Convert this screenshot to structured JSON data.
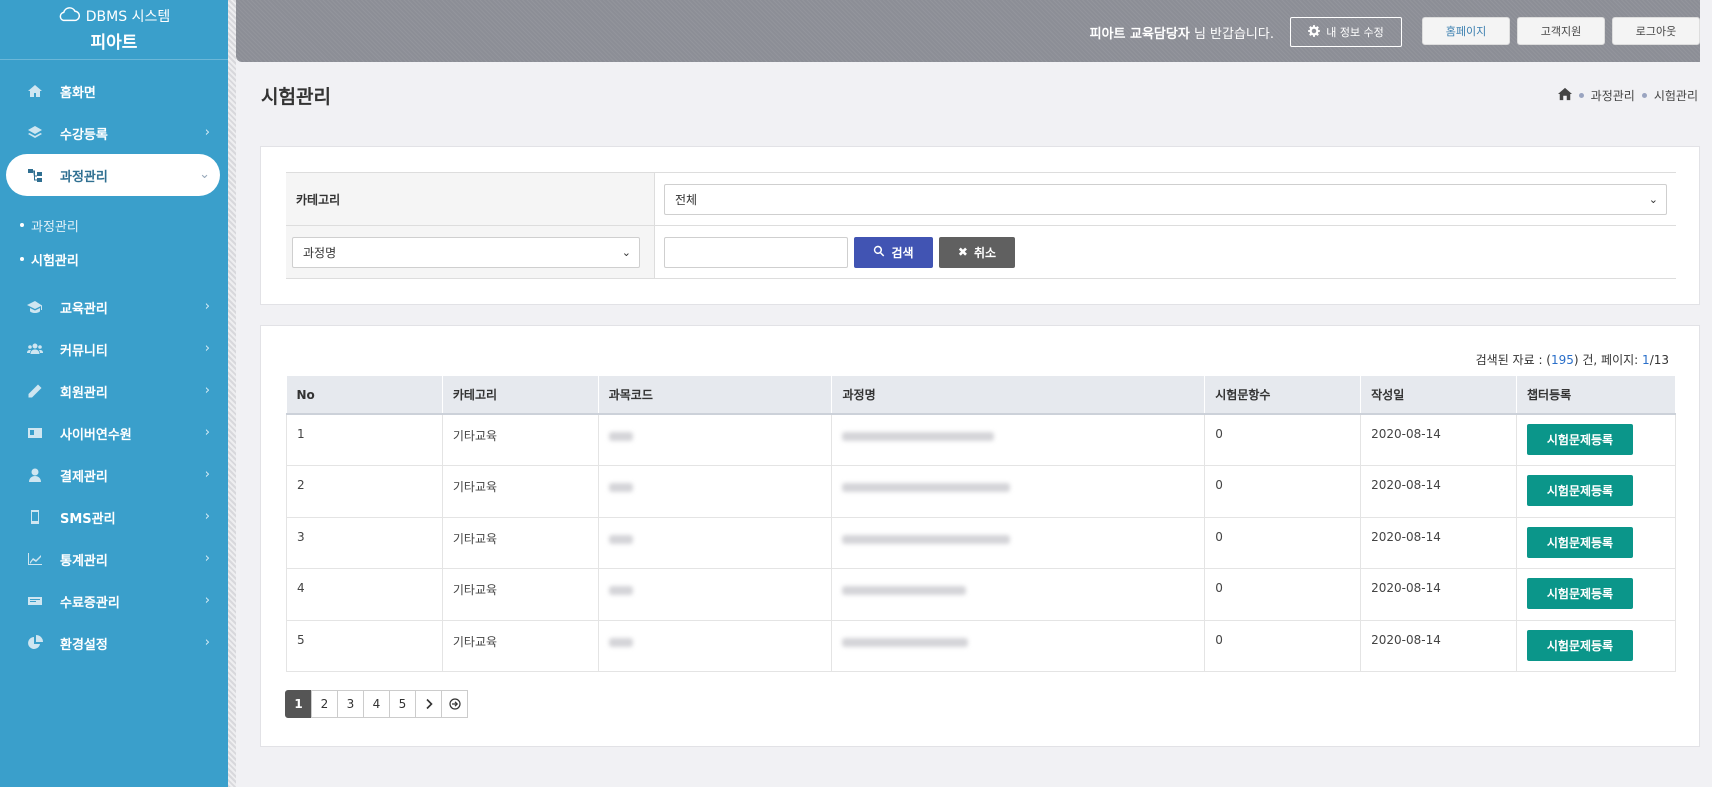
{
  "brand": {
    "system": "DBMS 시스템",
    "name": "피아트"
  },
  "sidebar": {
    "items": [
      {
        "label": "홈화면",
        "icon": "home-icon"
      },
      {
        "label": "수강등록",
        "icon": "layers-icon"
      },
      {
        "label": "과정관리",
        "icon": "sitemap-icon"
      },
      {
        "label": "교육관리",
        "icon": "graduation-cap-icon"
      },
      {
        "label": "커뮤니티",
        "icon": "users-icon"
      },
      {
        "label": "회원관리",
        "icon": "pencil-icon"
      },
      {
        "label": "사이버연수원",
        "icon": "id-card-icon"
      },
      {
        "label": "결제관리",
        "icon": "user-lock-icon"
      },
      {
        "label": "SMS관리",
        "icon": "mobile-icon"
      },
      {
        "label": "통계관리",
        "icon": "chart-icon"
      },
      {
        "label": "수료증관리",
        "icon": "certificate-icon"
      },
      {
        "label": "환경설정",
        "icon": "pie-icon"
      }
    ],
    "subitems": [
      "과정관리",
      "시험관리"
    ]
  },
  "header": {
    "user_name": "피아트 교육담당자",
    "greeting_suffix": " 님 반갑습니다.",
    "myinfo_label": "내 정보 수정",
    "home_label": "홈페이지",
    "support_label": "고객지원",
    "logout_label": "로그아웃"
  },
  "page": {
    "title": "시험관리",
    "breadcrumb": [
      "과정관리",
      "시험관리"
    ]
  },
  "search": {
    "category_label": "카테고리",
    "category_value": "전체",
    "field_select_value": "과정명",
    "keyword_value": "",
    "search_label": "검색",
    "cancel_label": "취소"
  },
  "results": {
    "prefix": "검색된 자료 : (",
    "count": "195",
    "mid": ") 건, 페이지: ",
    "page": "1",
    "total_pages": "/13"
  },
  "table": {
    "headers": [
      "No",
      "카테고리",
      "과목코드",
      "과정명",
      "시험문항수",
      "작성일",
      "챕터등록"
    ],
    "action_label": "시험문제등록",
    "rows": [
      {
        "no": "1",
        "category": "기타교육",
        "questions": "0",
        "date": "2020-08-14"
      },
      {
        "no": "2",
        "category": "기타교육",
        "questions": "0",
        "date": "2020-08-14"
      },
      {
        "no": "3",
        "category": "기타교육",
        "questions": "0",
        "date": "2020-08-14"
      },
      {
        "no": "4",
        "category": "기타교육",
        "questions": "0",
        "date": "2020-08-14"
      },
      {
        "no": "5",
        "category": "기타교육",
        "questions": "0",
        "date": "2020-08-14"
      }
    ]
  },
  "pagination": {
    "pages": [
      "1",
      "2",
      "3",
      "4",
      "5"
    ],
    "current": "1"
  }
}
